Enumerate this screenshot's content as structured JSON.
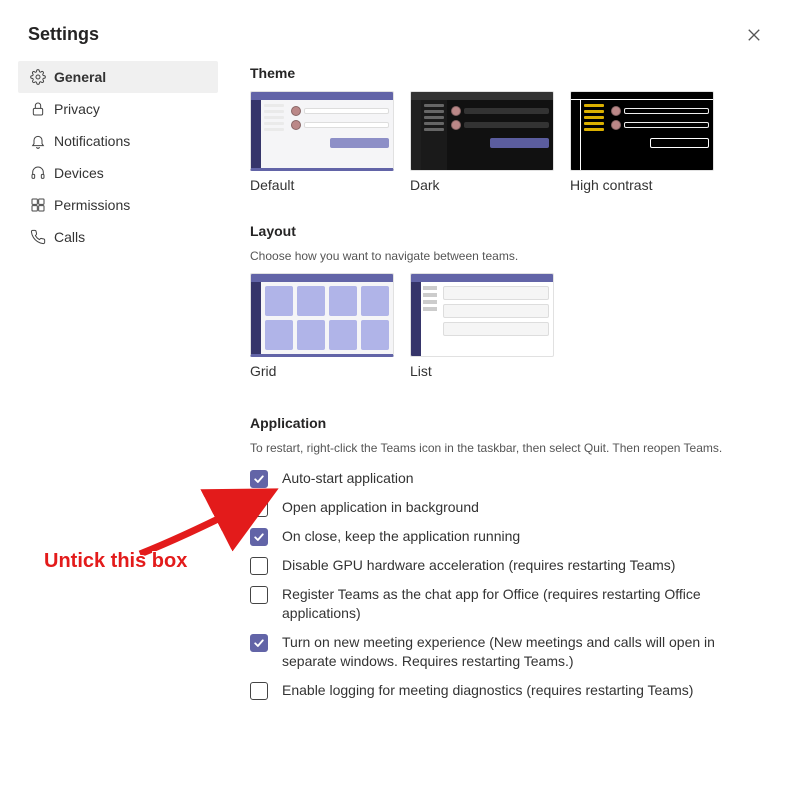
{
  "title": "Settings",
  "sidebar": {
    "items": [
      {
        "label": "General",
        "active": true
      },
      {
        "label": "Privacy",
        "active": false
      },
      {
        "label": "Notifications",
        "active": false
      },
      {
        "label": "Devices",
        "active": false
      },
      {
        "label": "Permissions",
        "active": false
      },
      {
        "label": "Calls",
        "active": false
      }
    ]
  },
  "theme": {
    "title": "Theme",
    "options": [
      {
        "label": "Default",
        "active": true
      },
      {
        "label": "Dark",
        "active": false
      },
      {
        "label": "High contrast",
        "active": false
      }
    ]
  },
  "layout": {
    "title": "Layout",
    "desc": "Choose how you want to navigate between teams.",
    "options": [
      {
        "label": "Grid",
        "active": true
      },
      {
        "label": "List",
        "active": false
      }
    ]
  },
  "application": {
    "title": "Application",
    "desc": "To restart, right-click the Teams icon in the taskbar, then select Quit. Then reopen Teams.",
    "checks": [
      {
        "label": "Auto-start application",
        "checked": true
      },
      {
        "label": "Open application in background",
        "checked": false
      },
      {
        "label": "On close, keep the application running",
        "checked": true
      },
      {
        "label": "Disable GPU hardware acceleration (requires restarting Teams)",
        "checked": false
      },
      {
        "label": "Register Teams as the chat app for Office (requires restarting Office applications)",
        "checked": false
      },
      {
        "label": "Turn on new meeting experience (New meetings and calls will open in separate windows. Requires restarting Teams.)",
        "checked": true
      },
      {
        "label": "Enable logging for meeting diagnostics (requires restarting Teams)",
        "checked": false
      }
    ]
  },
  "annotation": {
    "text": "Untick this box"
  }
}
